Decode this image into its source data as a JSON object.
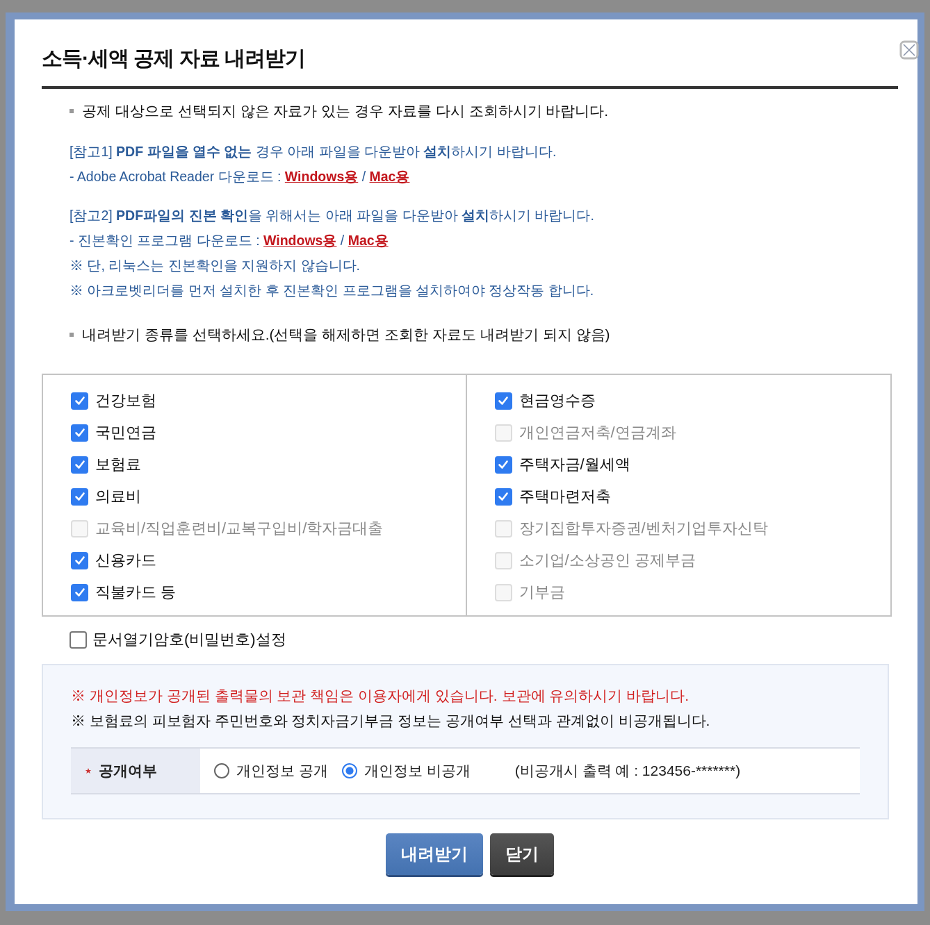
{
  "dialog": {
    "title": "소득·세액 공제 자료 내려받기"
  },
  "intro": "공제 대상으로 선택되지 않은 자료가 있는 경우 자료를 다시 조회하시기 바랍니다.",
  "note_groups": [
    {
      "lines": [
        [
          {
            "kind": "text",
            "text": "[참고1] **PDF 파일을 열수 없는** 경우  아래 파일을 다운받아 **설치**하시기 바랍니다."
          }
        ],
        [
          {
            "kind": "text",
            "text": "- Adobe Acrobat Reader 다운로드 :"
          },
          {
            "kind": "link",
            "text": "Windows용"
          },
          {
            "kind": "text",
            "text": "/"
          },
          {
            "kind": "link",
            "text": "Mac용"
          }
        ]
      ]
    },
    {
      "lines": [
        [
          {
            "kind": "text",
            "text": "[참고2] **PDF파일의 진본 확인**을 위해서는 아래 파일을 다운받아 **설치**하시기 바랍니다."
          }
        ],
        [
          {
            "kind": "text",
            "text": "- 진본확인 프로그램 다운로드 :"
          },
          {
            "kind": "link",
            "text": "Windows용"
          },
          {
            "kind": "text",
            "text": "/"
          },
          {
            "kind": "link",
            "text": "Mac용"
          }
        ],
        [
          {
            "kind": "text",
            "text": "※ 단, 리눅스는 진본확인을 지원하지 않습니다."
          }
        ],
        [
          {
            "kind": "text",
            "text": "※ 아크로벳리더를 먼저 설치한 후 진본확인 프로그램을 설치하여야 정상작동 합니다."
          }
        ]
      ]
    }
  ],
  "select_prompt": "내려받기 종류를 선택하세요.(선택을 해제하면 조회한 자료도 내려받기 되지 않음)",
  "columns": [
    [
      {
        "label": "건강보험",
        "checked": true,
        "disabled": false
      },
      {
        "label": "국민연금",
        "checked": true,
        "disabled": false
      },
      {
        "label": "보험료",
        "checked": true,
        "disabled": false
      },
      {
        "label": "의료비",
        "checked": true,
        "disabled": false
      },
      {
        "label": "교육비/직업훈련비/교복구입비/학자금대출",
        "checked": false,
        "disabled": true
      },
      {
        "label": "신용카드",
        "checked": true,
        "disabled": false
      },
      {
        "label": "직불카드 등",
        "checked": true,
        "disabled": false
      }
    ],
    [
      {
        "label": "현금영수증",
        "checked": true,
        "disabled": false
      },
      {
        "label": "개인연금저축/연금계좌",
        "checked": false,
        "disabled": true
      },
      {
        "label": "주택자금/월세액",
        "checked": true,
        "disabled": false
      },
      {
        "label": "주택마련저축",
        "checked": true,
        "disabled": false
      },
      {
        "label": "장기집합투자증권/벤처기업투자신탁",
        "checked": false,
        "disabled": true
      },
      {
        "label": "소기업/소상공인 공제부금",
        "checked": false,
        "disabled": true
      },
      {
        "label": "기부금",
        "checked": false,
        "disabled": true
      }
    ]
  ],
  "password_option": {
    "label": "문서열기암호(비밀번호)설정",
    "checked": false
  },
  "privacy": {
    "warnings": [
      {
        "text": "※ 개인정보가 공개된 출력물의 보관 책임은 이용자에게 있습니다. 보관에 유의하시기 바랍니다.",
        "kind": "alert"
      },
      {
        "text": "※ 보험료의 피보험자 주민번호와 정치자금기부금 정보는 공개여부 선택과 관계없이 비공개됩니다.",
        "kind": "plain"
      }
    ],
    "field_label": "공개여부",
    "options": [
      {
        "label": "개인정보 공개",
        "selected": false
      },
      {
        "label": "개인정보 비공개",
        "selected": true
      }
    ],
    "hint": "(비공개시 출력 예 : 123456-*******)"
  },
  "buttons": [
    {
      "label": "내려받기",
      "kind": "primary"
    },
    {
      "label": "닫기",
      "kind": "secondary"
    }
  ]
}
